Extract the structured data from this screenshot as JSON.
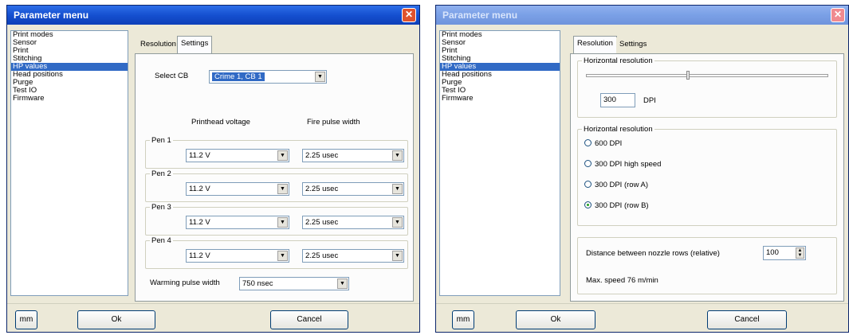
{
  "left": {
    "title": "Parameter menu",
    "close": "✕",
    "menu": [
      "Print modes",
      "Sensor",
      "Print",
      "Stitching",
      "HP values",
      "Head positions",
      "Purge",
      "Test IO",
      "Firmware"
    ],
    "selected_menu": "HP values",
    "tabs": [
      "Resolution",
      "Settings"
    ],
    "active_tab": "Settings",
    "select_cb_label": "Select CB",
    "select_cb_value": "Crime 1, CB 1",
    "col_voltage": "Printhead voltage",
    "col_pulse": "Fire pulse width",
    "pens": [
      {
        "label": "Pen 1",
        "voltage": "11.2 V",
        "pulse": "2.25 usec"
      },
      {
        "label": "Pen 2",
        "voltage": "11.2 V",
        "pulse": "2.25 usec"
      },
      {
        "label": "Pen 3",
        "voltage": "11.2 V",
        "pulse": "2.25 usec"
      },
      {
        "label": "Pen 4",
        "voltage": "11.2 V",
        "pulse": "2.25 usec"
      }
    ],
    "warming_label": "Warming pulse width",
    "warming_value": "750 nsec",
    "mm_button": "mm",
    "ok_button": "Ok",
    "cancel_button": "Cancel"
  },
  "right": {
    "title": "Parameter menu",
    "close": "✕",
    "menu": [
      "Print modes",
      "Sensor",
      "Print",
      "Stitching",
      "HP values",
      "Head positions",
      "Purge",
      "Test IO",
      "Firmware"
    ],
    "selected_menu": "HP values",
    "tabs": [
      "Resolution",
      "Settings"
    ],
    "active_tab": "Resolution",
    "hres_group_title": "Horizontal resolution",
    "hres_slider_level": 0.42,
    "hres_value": "300",
    "hres_unit": "DPI",
    "hres_group2_title": "Horizontal resolution",
    "radios": [
      {
        "label": "600 DPI",
        "checked": false
      },
      {
        "label": "300 DPI high speed",
        "checked": false
      },
      {
        "label": "300 DPI (row A)",
        "checked": false
      },
      {
        "label": "300 DPI (row B)",
        "checked": true
      }
    ],
    "distance_label": "Distance between nozzle rows (relative)",
    "distance_value": "100",
    "max_speed": "Max. speed 76 m/min",
    "mm_button": "mm",
    "ok_button": "Ok",
    "cancel_button": "Cancel"
  }
}
